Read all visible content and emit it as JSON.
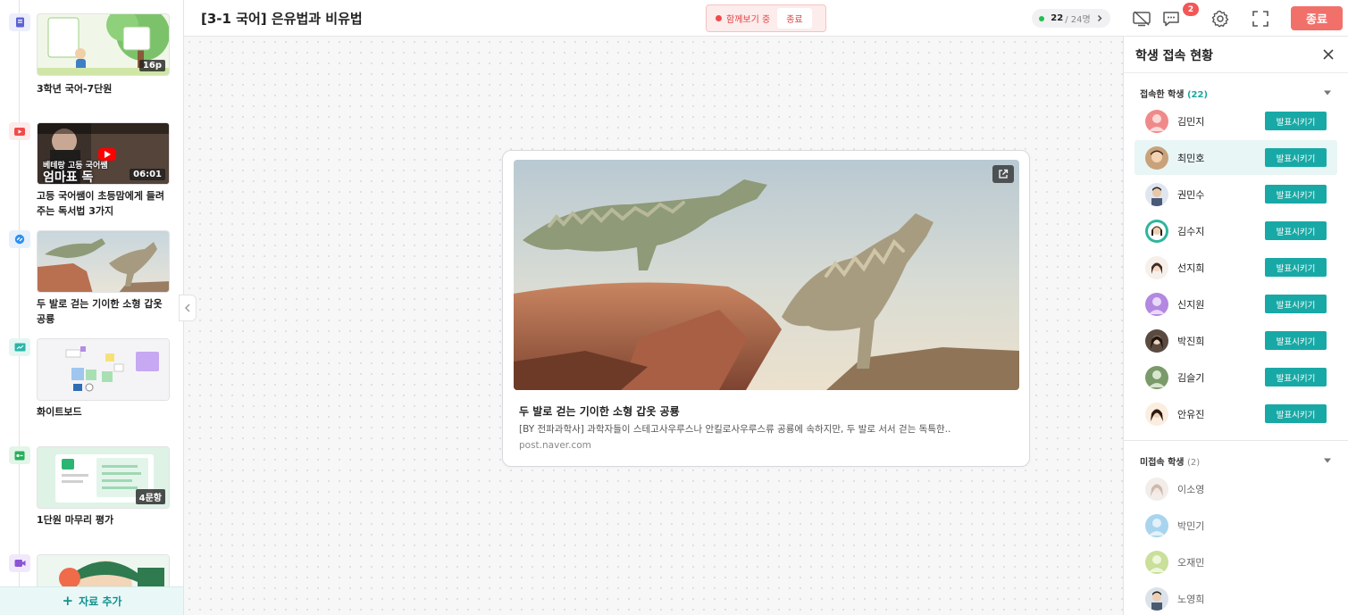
{
  "topbar": {
    "title": "[3-1 국어] 은유법과 비유법",
    "together_status": "함께보기 중",
    "together_end": "종료",
    "online_current": "22",
    "online_total": "/ 24명",
    "chat_badge": "2",
    "end_label": "종료"
  },
  "sidebar": {
    "items": [
      {
        "type": "document",
        "title": "3학년 국어-7단원",
        "badge": "16p",
        "color": "#5b63d6"
      },
      {
        "type": "video",
        "title": "고등 국어쌤이 초등맘에게 들려주는 독서법 3가지",
        "badge": "06:01",
        "overlay_text": "베테랑 고등 국어쌤",
        "overlay_text2": "엄마표 독",
        "color": "#ef4b4b"
      },
      {
        "type": "link",
        "title": "두 발로 걷는 기이한 소형 갑옷 공룡",
        "badge": "",
        "color": "#2f8ff0"
      },
      {
        "type": "whiteboard",
        "title": "화이트보드",
        "badge": "",
        "color": "#2bb5a8"
      },
      {
        "type": "quiz",
        "title": "1단원 마무리 평가",
        "badge": "4문항",
        "color": "#27b05c"
      },
      {
        "type": "live",
        "title": "",
        "badge": "",
        "color": "#8b55d6"
      }
    ],
    "add_label": "자료 추가"
  },
  "card": {
    "title": "두 발로 걷는 기이한 소형 갑옷 공룡",
    "description": "[BY 전파과학사] 과학자들이 스테고사우루스나 안킬로사우루스류 공룡에 속하지만, 두 발로 서서 걷는 독특한..",
    "url": "post.naver.com"
  },
  "panel": {
    "title": "학생 접속 현황",
    "connected_label": "접속한 학생",
    "connected_count": "(22)",
    "connected": [
      {
        "name": "김민지",
        "avatar": "#f08a8a"
      },
      {
        "name": "최민호",
        "avatar": "#c9a27a"
      },
      {
        "name": "권민수",
        "avatar": "#4a5a78"
      },
      {
        "name": "김수지",
        "avatar": "#2fb59c"
      },
      {
        "name": "선지희",
        "avatar": "#e7c9b4"
      },
      {
        "name": "신지원",
        "avatar": "#b388e0"
      },
      {
        "name": "박진희",
        "avatar": "#5a4a40"
      },
      {
        "name": "김슬기",
        "avatar": "#7a9a6a"
      },
      {
        "name": "안유진",
        "avatar": "#d9a46a"
      }
    ],
    "present_label": "발표시키기",
    "disconnected_label": "미접속 학생",
    "disconnected_count": "(2)",
    "disconnected": [
      {
        "name": "이소영",
        "avatar": "#d8c2b6"
      },
      {
        "name": "박민기",
        "avatar": "#a9d4ee"
      },
      {
        "name": "오재민",
        "avatar": "#c9df9a"
      },
      {
        "name": "노영희",
        "avatar": "#4a5a70"
      }
    ]
  },
  "colors": {
    "accent": "#18a9a6",
    "danger": "#f2706a"
  }
}
